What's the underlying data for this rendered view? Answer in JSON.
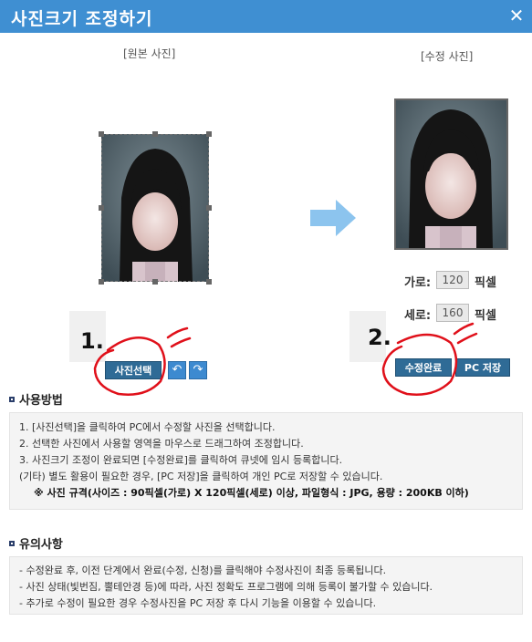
{
  "window": {
    "title": "사진크기 조정하기",
    "close_symbol": "✕"
  },
  "original_panel": {
    "label": "[원본 사진]"
  },
  "edited_panel": {
    "label": "[수정 사진]"
  },
  "dimensions": {
    "width_label": "가로:",
    "width_value": "120",
    "height_label": "세로:",
    "height_value": "160",
    "unit": "픽셀"
  },
  "buttons": {
    "select_photo": "사진선택",
    "rotate_left_icon": "↶",
    "rotate_right_icon": "↷",
    "complete_edit": "수정완료",
    "pc_save": "PC 저장"
  },
  "annotations": {
    "step1": "1.",
    "step2": "2."
  },
  "usage": {
    "title": "사용방법",
    "lines": [
      "1. [사진선택]을 클릭하여 PC에서 수정할 사진을 선택합니다.",
      "2. 선택한 사진에서 사용할 영역을 마우스로 드래그하여 조정합니다.",
      "3. 사진크기 조정이 완료되면 [수정완료]를 클릭하여 큐넷에 임시 등록합니다.",
      "(기타) 별도 활용이 필요한 경우, [PC 저장]을 클릭하여 개인 PC로 저장할 수 있습니다."
    ],
    "note": "※ 사진 규격(사이즈 : 90픽셀(가로) X 120픽셀(세로) 이상, 파일형식 : JPG, 용량 : 200KB 이하)"
  },
  "cautions": {
    "title": "유의사항",
    "lines": [
      "- 수정완료 후, 이전 단계에서 완료(수정, 신청)를 클릭해야 수정사진이 최종 등록됩니다.",
      "- 사진 상태(빛번짐, 뿔테안경 등)에 따라, 사진 정확도 프로그램에 의해 등록이 불가할 수 있습니다.",
      "- 추가로 수정이 필요한 경우 수정사진을 PC 저장 후 다시 기능을 이용할 수 있습니다."
    ]
  },
  "colors": {
    "title_bar": "#3f8fd2",
    "button_dark": "#2f6b96",
    "icon_button": "#3d8ad0",
    "arrow": "#8cc4ee",
    "annotation_red": "#e0101a"
  }
}
